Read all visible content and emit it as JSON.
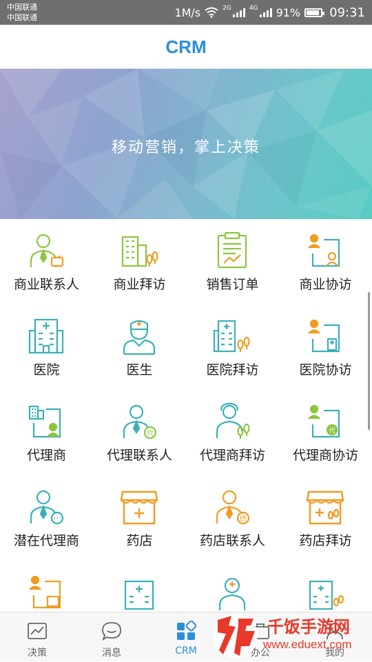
{
  "status": {
    "carrier1": "中国联通",
    "carrier2": "中国联通",
    "speed": "1M/s",
    "net1": "2G",
    "net2": "4G",
    "battery": "91%",
    "battery_level": 0.91,
    "time": "09:31"
  },
  "header": {
    "title": "CRM"
  },
  "banner": {
    "slogan": "移动营销，掌上决策"
  },
  "colors": {
    "brand": "#2a8fd8",
    "green": "#8cc63f",
    "teal": "#3ab0b8",
    "orange": "#f29b20"
  },
  "grid": [
    {
      "label": "商业联系人",
      "icon": "business-contact-icon"
    },
    {
      "label": "商业拜访",
      "icon": "business-visit-icon"
    },
    {
      "label": "销售订单",
      "icon": "sales-order-icon"
    },
    {
      "label": "商业协访",
      "icon": "business-assist-visit-icon"
    },
    {
      "label": "医院",
      "icon": "hospital-icon"
    },
    {
      "label": "医生",
      "icon": "doctor-icon"
    },
    {
      "label": "医院拜访",
      "icon": "hospital-visit-icon"
    },
    {
      "label": "医院协访",
      "icon": "hospital-assist-visit-icon"
    },
    {
      "label": "代理商",
      "icon": "agent-icon"
    },
    {
      "label": "代理联系人",
      "icon": "agent-contact-icon"
    },
    {
      "label": "代理商拜访",
      "icon": "agent-visit-icon"
    },
    {
      "label": "代理商协访",
      "icon": "agent-assist-visit-icon"
    },
    {
      "label": "潜在代理商",
      "icon": "potential-agent-icon"
    },
    {
      "label": "药店",
      "icon": "pharmacy-icon"
    },
    {
      "label": "药店联系人",
      "icon": "pharmacy-contact-icon"
    },
    {
      "label": "药店拜访",
      "icon": "pharmacy-visit-icon"
    },
    {
      "label": "",
      "icon": "pharmacy-assist-icon"
    },
    {
      "label": "",
      "icon": "clinic-icon"
    },
    {
      "label": "",
      "icon": "clinic-doctor-icon"
    },
    {
      "label": "",
      "icon": "clinic-visit-icon"
    }
  ],
  "tabs": [
    {
      "label": "决策",
      "icon": "chart-icon"
    },
    {
      "label": "消息",
      "icon": "message-icon"
    },
    {
      "label": "CRM",
      "icon": "crm-icon"
    },
    {
      "label": "办公",
      "icon": "office-icon"
    },
    {
      "label": "我的",
      "icon": "user-icon"
    }
  ],
  "watermark": {
    "brand": "千饭手游网",
    "url": "www.eduext.com"
  }
}
